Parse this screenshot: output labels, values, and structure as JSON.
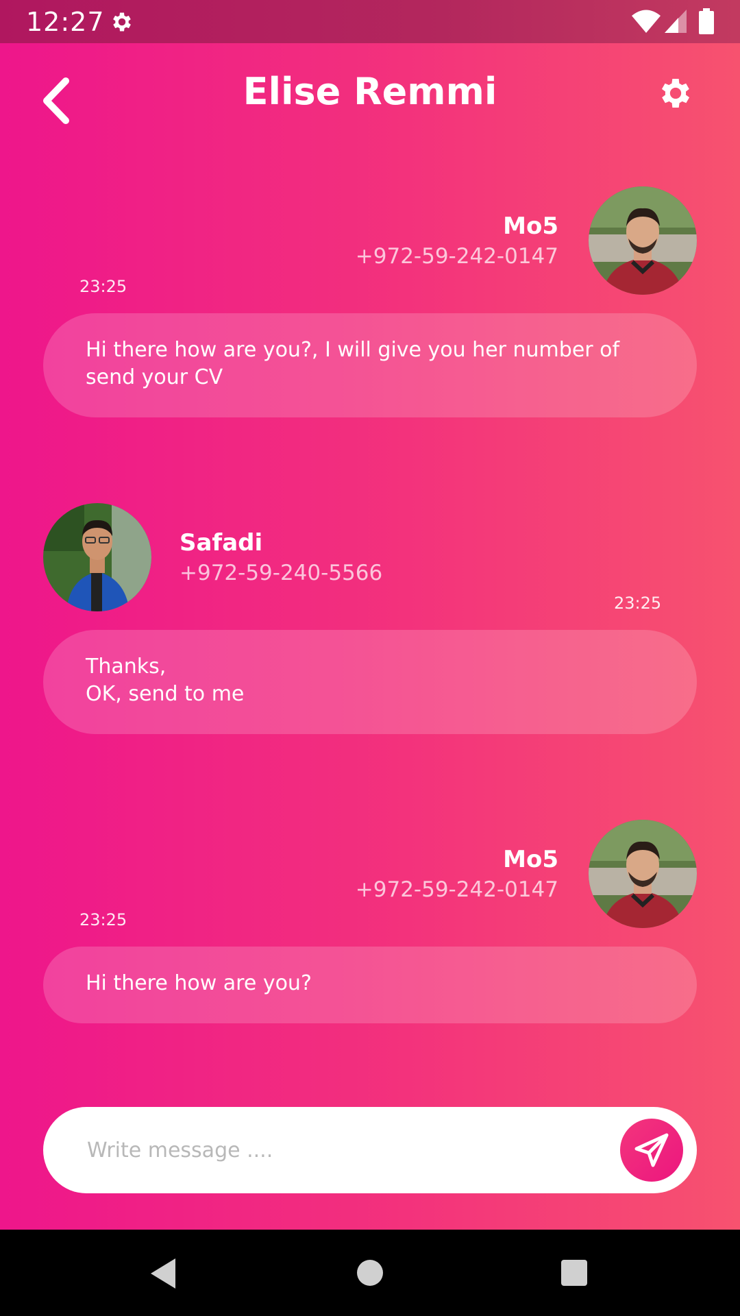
{
  "status_bar": {
    "time": "12:27"
  },
  "header": {
    "title": "Elise Remmi"
  },
  "messages": [
    {
      "sender": "Mo5",
      "phone": "+972-59-242-0147",
      "time": "23:25",
      "text": "Hi there how are you?, I will give you her number of send your CV"
    },
    {
      "sender": "Safadi",
      "phone": "+972-59-240-5566",
      "time": "23:25",
      "text": "Thanks,\nOK, send to me"
    },
    {
      "sender": "Mo5",
      "phone": "+972-59-242-0147",
      "time": "23:25",
      "text": "Hi there how are you?"
    }
  ],
  "composer": {
    "placeholder": "Write message ...."
  },
  "icons": {
    "status": [
      "settings-icon",
      "wifi-icon",
      "signal-icon",
      "battery-icon"
    ],
    "header": [
      "back-icon",
      "settings-icon"
    ],
    "composer": [
      "send-icon"
    ],
    "nav": [
      "nav-back-icon",
      "nav-home-icon",
      "nav-recents-icon"
    ]
  },
  "colors": {
    "gradient_start": "#ee168b",
    "gradient_end": "#f7526f",
    "accent": "#ec167f"
  }
}
